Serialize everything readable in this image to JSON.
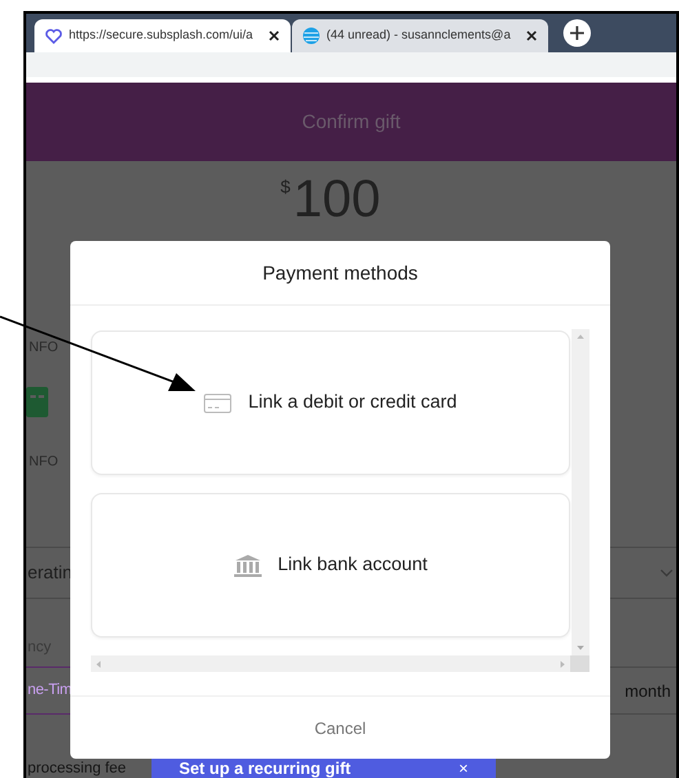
{
  "browser": {
    "tabs": [
      {
        "title": "https://secure.subsplash.com/ui/a",
        "selected": true
      },
      {
        "title": "(44 unread) - susannclements@a",
        "selected": false
      }
    ]
  },
  "page": {
    "header": "Confirm gift",
    "currency": "$",
    "amount": "100",
    "info_labels": [
      "NFO",
      "NFO"
    ],
    "fund": "eratin",
    "frequency_label": "ncy",
    "frequency_options": [
      {
        "label": "ne-Tim",
        "selected": true
      },
      {
        "label": "month",
        "selected": false
      }
    ],
    "fee_label": "processing fee",
    "banner": {
      "text": "Set up a recurring gift",
      "close": "×"
    }
  },
  "modal": {
    "title": "Payment methods",
    "options": [
      {
        "kind": "card",
        "label": "Link a debit or credit card"
      },
      {
        "kind": "bank",
        "label": "Link bank account"
      }
    ],
    "cancel": "Cancel"
  }
}
